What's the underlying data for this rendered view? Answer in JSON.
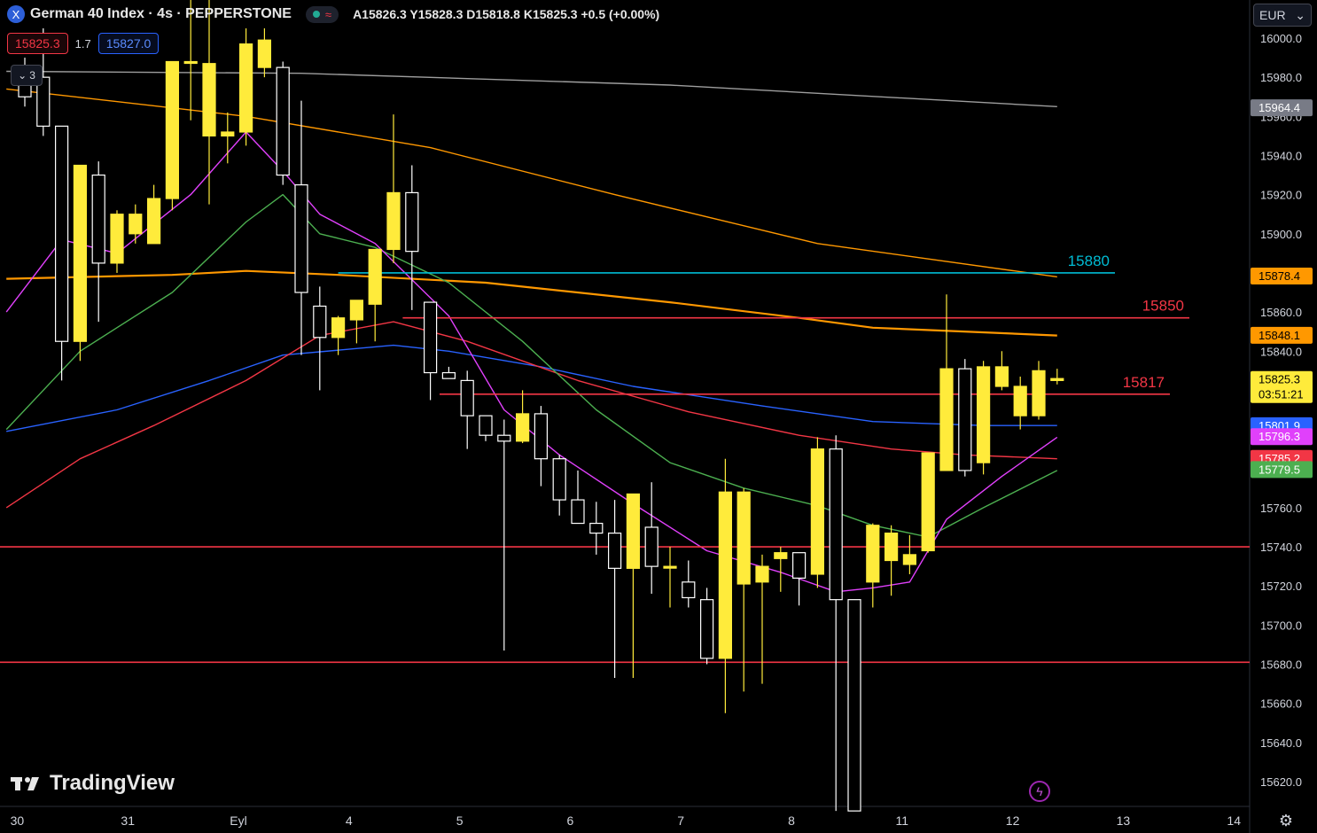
{
  "header": {
    "symbol_icon": "X",
    "symbol_name": "German 40 Index · 4s · PEPPERSTONE",
    "status_icon_green": "market-open-dot",
    "status_icon_wave": "≈",
    "ohlc": "A15826.3  Y15828.3  D15818.8  K15825.3  +0.5 (+0.00%)"
  },
  "trade": {
    "sell_price": "15825.3",
    "spread": "1.7",
    "buy_price": "15827.0"
  },
  "indicator_toggle": {
    "label": "3"
  },
  "currency": {
    "value": "EUR"
  },
  "logo": {
    "text": "TradingView"
  },
  "chart_data": {
    "type": "candlestick",
    "ylim": [
      15605,
      16010
    ],
    "y_ticks": [
      16000,
      15980,
      15960,
      15940,
      15920,
      15900,
      15860,
      15840,
      15760,
      15740,
      15720,
      15700,
      15680,
      15660,
      15640,
      15620
    ],
    "x_labels": [
      {
        "label": "30",
        "slot": 0.5
      },
      {
        "label": "31",
        "slot": 6.5
      },
      {
        "label": "Eyl",
        "slot": 12.5
      },
      {
        "label": "4",
        "slot": 18.5
      },
      {
        "label": "5",
        "slot": 24.5
      },
      {
        "label": "6",
        "slot": 30.5
      },
      {
        "label": "7",
        "slot": 36.5
      },
      {
        "label": "8",
        "slot": 42.5
      },
      {
        "label": "11",
        "slot": 48.5
      },
      {
        "label": "12",
        "slot": 54.5
      },
      {
        "label": "13",
        "slot": 60.5
      },
      {
        "label": "14",
        "slot": 66.5
      }
    ],
    "candles": [
      {
        "o": 15985,
        "h": 15990,
        "l": 15965,
        "c": 15970
      },
      {
        "o": 15980,
        "h": 16005,
        "l": 15950,
        "c": 15955
      },
      {
        "o": 15955,
        "h": 15955,
        "l": 15825,
        "c": 15845
      },
      {
        "o": 15845,
        "h": 15935,
        "l": 15835,
        "c": 15935
      },
      {
        "o": 15930,
        "h": 15937,
        "l": 15855,
        "c": 15885
      },
      {
        "o": 15885,
        "h": 15912,
        "l": 15880,
        "c": 15910
      },
      {
        "o": 15900,
        "h": 15915,
        "l": 15895,
        "c": 15910
      },
      {
        "o": 15895,
        "h": 15925,
        "l": 15895,
        "c": 15918
      },
      {
        "o": 15918,
        "h": 15988,
        "l": 15912,
        "c": 15988
      },
      {
        "o": 15988,
        "h": 16035,
        "l": 15958,
        "c": 15988
      },
      {
        "o": 15950,
        "h": 16035,
        "l": 15915,
        "c": 15987
      },
      {
        "o": 15950,
        "h": 15962,
        "l": 15936,
        "c": 15952
      },
      {
        "o": 15952,
        "h": 16005,
        "l": 15945,
        "c": 15997
      },
      {
        "o": 15985,
        "h": 16005,
        "l": 15980,
        "c": 15999
      },
      {
        "o": 15985,
        "h": 15988,
        "l": 15925,
        "c": 15930
      },
      {
        "o": 15925,
        "h": 15968,
        "l": 15838,
        "c": 15870
      },
      {
        "o": 15863,
        "h": 15873,
        "l": 15820,
        "c": 15847
      },
      {
        "o": 15847,
        "h": 15858,
        "l": 15838,
        "c": 15857
      },
      {
        "o": 15856,
        "h": 15864,
        "l": 15844,
        "c": 15866
      },
      {
        "o": 15864,
        "h": 15892,
        "l": 15845,
        "c": 15892
      },
      {
        "o": 15892,
        "h": 15961,
        "l": 15885,
        "c": 15921
      },
      {
        "o": 15921,
        "h": 15935,
        "l": 15861,
        "c": 15891
      },
      {
        "o": 15865,
        "h": 15865,
        "l": 15815,
        "c": 15829
      },
      {
        "o": 15829,
        "h": 15832,
        "l": 15829,
        "c": 15826
      },
      {
        "o": 15825,
        "h": 15830,
        "l": 15790,
        "c": 15807
      },
      {
        "o": 15807,
        "h": 15804,
        "l": 15794,
        "c": 15797
      },
      {
        "o": 15797,
        "h": 15805,
        "l": 15687,
        "c": 15794
      },
      {
        "o": 15794,
        "h": 15820,
        "l": 15793,
        "c": 15808
      },
      {
        "o": 15808,
        "h": 15812,
        "l": 15771,
        "c": 15785
      },
      {
        "o": 15785,
        "h": 15787,
        "l": 15756,
        "c": 15764
      },
      {
        "o": 15764,
        "h": 15779,
        "l": 15757,
        "c": 15752
      },
      {
        "o": 15752,
        "h": 15763,
        "l": 15736,
        "c": 15747
      },
      {
        "o": 15747,
        "h": 15764,
        "l": 15673,
        "c": 15729
      },
      {
        "o": 15729,
        "h": 15767,
        "l": 15673,
        "c": 15767
      },
      {
        "o": 15750,
        "h": 15773,
        "l": 15716,
        "c": 15730
      },
      {
        "o": 15730,
        "h": 15740,
        "l": 15709,
        "c": 15730
      },
      {
        "o": 15722,
        "h": 15733,
        "l": 15709,
        "c": 15714
      },
      {
        "o": 15713,
        "h": 15719,
        "l": 15680,
        "c": 15683
      },
      {
        "o": 15683,
        "h": 15785,
        "l": 15655,
        "c": 15768
      },
      {
        "o": 15721,
        "h": 15770,
        "l": 15666,
        "c": 15768
      },
      {
        "o": 15722,
        "h": 15736,
        "l": 15670,
        "c": 15730
      },
      {
        "o": 15734,
        "h": 15740,
        "l": 15717,
        "c": 15737
      },
      {
        "o": 15737,
        "h": 15737,
        "l": 15710,
        "c": 15724
      },
      {
        "o": 15726,
        "h": 15796,
        "l": 15719,
        "c": 15790
      },
      {
        "o": 15790,
        "h": 15797,
        "l": 15605,
        "c": 15713
      },
      {
        "o": 15713,
        "h": 15713,
        "l": 15605,
        "c": 15605
      },
      {
        "o": 15722,
        "h": 15752,
        "l": 15709,
        "c": 15751
      },
      {
        "o": 15733,
        "h": 15751,
        "l": 15715,
        "c": 15747
      },
      {
        "o": 15731,
        "h": 15746,
        "l": 15726,
        "c": 15736
      },
      {
        "o": 15738,
        "h": 15788,
        "l": 15737,
        "c": 15788
      },
      {
        "o": 15779,
        "h": 15869,
        "l": 15780,
        "c": 15831
      },
      {
        "o": 15831,
        "h": 15836,
        "l": 15776,
        "c": 15779
      },
      {
        "o": 15783,
        "h": 15835,
        "l": 15777,
        "c": 15832
      },
      {
        "o": 15822,
        "h": 15840,
        "l": 15820,
        "c": 15832
      },
      {
        "o": 15807,
        "h": 15827,
        "l": 15800,
        "c": 15822
      },
      {
        "o": 15807,
        "h": 15835,
        "l": 15805,
        "c": 15830
      },
      {
        "o": 15825,
        "h": 15831,
        "l": 15823,
        "c": 15826
      }
    ],
    "hlines": [
      {
        "value": 15880,
        "label": "15880",
        "color": "#00bcd4",
        "from_slot": 17
      },
      {
        "value": 15857,
        "label": "15850",
        "color": "#f23645",
        "from_slot": 20.5
      },
      {
        "value": 15818,
        "label": "15817",
        "color": "#f23645",
        "from_slot": 22.5
      },
      {
        "value": 15740,
        "label": "",
        "color": "#f23645",
        "from_slot": -1
      },
      {
        "value": 15681,
        "label": "",
        "color": "#f23645",
        "from_slot": -1
      }
    ],
    "moving_averages": [
      {
        "color": "#9e9e9e",
        "values": [
          [
            -1,
            15983
          ],
          [
            15,
            15982
          ],
          [
            35,
            15976
          ],
          [
            56,
            15965
          ]
        ]
      },
      {
        "color": "#ff9800",
        "values": [
          [
            -1,
            15974
          ],
          [
            12,
            15960
          ],
          [
            22,
            15944
          ],
          [
            32,
            15920
          ],
          [
            43,
            15895
          ],
          [
            56,
            15878
          ]
        ]
      },
      {
        "color": "#ff9800",
        "values": [
          [
            -1,
            15877
          ],
          [
            8,
            15879
          ],
          [
            12,
            15881
          ],
          [
            17,
            15879
          ],
          [
            25,
            15875
          ],
          [
            35,
            15865
          ],
          [
            42,
            15857
          ],
          [
            46,
            15852
          ],
          [
            56,
            15848
          ]
        ]
      },
      {
        "color": "#2962ff",
        "values": [
          [
            -1,
            15799
          ],
          [
            5,
            15810
          ],
          [
            10,
            15825
          ],
          [
            14,
            15838
          ],
          [
            20,
            15843
          ],
          [
            23,
            15840
          ],
          [
            28,
            15832
          ],
          [
            33,
            15822
          ],
          [
            40,
            15812
          ],
          [
            46,
            15804
          ],
          [
            52,
            15802
          ],
          [
            56,
            15802
          ]
        ]
      },
      {
        "color": "#f23645",
        "values": [
          [
            -1,
            15760
          ],
          [
            3,
            15785
          ],
          [
            7,
            15802
          ],
          [
            12,
            15825
          ],
          [
            16,
            15848
          ],
          [
            20,
            15855
          ],
          [
            24,
            15845
          ],
          [
            30,
            15825
          ],
          [
            36,
            15809
          ],
          [
            42,
            15797
          ],
          [
            47,
            15790
          ],
          [
            51,
            15787
          ],
          [
            56,
            15785
          ]
        ]
      },
      {
        "color": "#4caf50",
        "values": [
          [
            -1,
            15800
          ],
          [
            3,
            15840
          ],
          [
            8,
            15870
          ],
          [
            12,
            15906
          ],
          [
            14,
            15920
          ],
          [
            16,
            15900
          ],
          [
            19,
            15893
          ],
          [
            23,
            15875
          ],
          [
            27,
            15845
          ],
          [
            31,
            15810
          ],
          [
            35,
            15783
          ],
          [
            39,
            15770
          ],
          [
            43,
            15761
          ],
          [
            46,
            15751
          ],
          [
            49,
            15745
          ],
          [
            52,
            15760
          ],
          [
            56,
            15779
          ]
        ]
      },
      {
        "color": "#e040fb",
        "values": [
          [
            -1,
            15860
          ],
          [
            2,
            15897
          ],
          [
            5,
            15890
          ],
          [
            9,
            15920
          ],
          [
            12,
            15952
          ],
          [
            14,
            15932
          ],
          [
            16,
            15910
          ],
          [
            19,
            15895
          ],
          [
            23,
            15858
          ],
          [
            26,
            15810
          ],
          [
            29,
            15787
          ],
          [
            33,
            15762
          ],
          [
            37,
            15738
          ],
          [
            41,
            15727
          ],
          [
            44,
            15717
          ],
          [
            46,
            15719
          ],
          [
            48,
            15722
          ],
          [
            50,
            15754
          ],
          [
            53,
            15776
          ],
          [
            56,
            15796
          ]
        ]
      }
    ],
    "price_tags": [
      {
        "label": "15964.4",
        "value": 15964.4,
        "bg": "#787b86",
        "fg": "#ffffff"
      },
      {
        "label": "15878.4",
        "value": 15878.4,
        "bg": "#ff9800",
        "fg": "#000000"
      },
      {
        "label": "15848.1",
        "value": 15848.1,
        "bg": "#ff9800",
        "fg": "#000000"
      },
      {
        "label": "15825.3",
        "sub": "03:51:21",
        "value": 15825.3,
        "bg": "#ffeb3b",
        "fg": "#000000"
      },
      {
        "label": "15801.9",
        "value": 15801.9,
        "bg": "#2962ff",
        "fg": "#ffffff"
      },
      {
        "label": "15796.3",
        "value": 15796.3,
        "bg": "#e040fb",
        "fg": "#ffffff"
      },
      {
        "label": "15785.2",
        "value": 15785.2,
        "bg": "#f23645",
        "fg": "#ffffff"
      },
      {
        "label": "15779.5",
        "value": 15779.5,
        "bg": "#4caf50",
        "fg": "#ffffff"
      }
    ],
    "colors": {
      "up": "#ffeb3b",
      "down": "#000000",
      "wick": "#ffffff",
      "bg": "#000000"
    }
  }
}
